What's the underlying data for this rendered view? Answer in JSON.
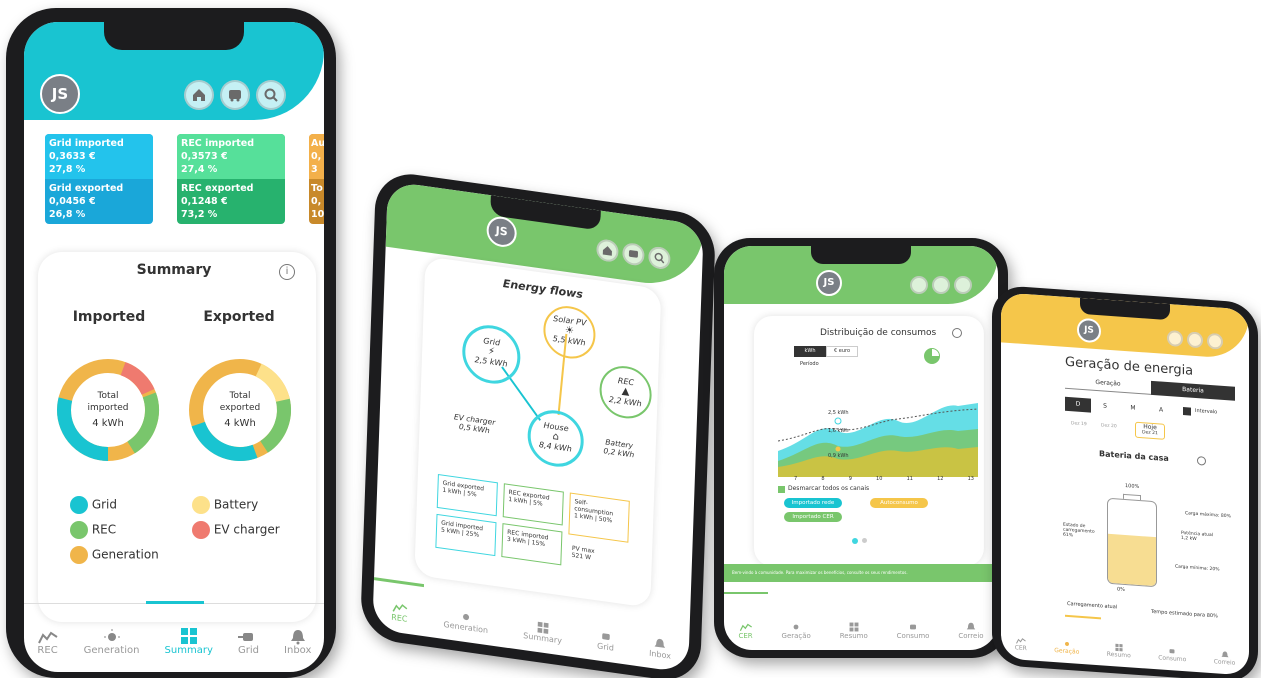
{
  "colors": {
    "teal": "#19c4d1",
    "green": "#79c66c",
    "yellow": "#f5c64a",
    "orange": "#f0b54a",
    "red": "#ef7a6f",
    "gold": "#e9b96a",
    "cyan": "#3fd6e0"
  },
  "phone1": {
    "avatar": "JS",
    "cards": [
      {
        "label": "Grid imported",
        "value": "0,3633 €",
        "pct": "27,8 %",
        "label2": "Grid exported",
        "value2": "0,0456 €",
        "pct2": "26,8 %"
      },
      {
        "label": "REC imported",
        "value": "0,3573 €",
        "pct": "27,4 %",
        "label2": "REC exported",
        "value2": "0,1248 €",
        "pct2": "73,2 %"
      },
      {
        "label": "Au",
        "value": "0,",
        "pct": "3",
        "label2": "To",
        "value2": "0,",
        "pct2": "10"
      }
    ],
    "summary_title": "Summary",
    "imported_title": "Imported",
    "exported_title": "Exported",
    "donut_imported": {
      "line1": "Total",
      "line2": "imported",
      "value": "4 kWh"
    },
    "donut_exported": {
      "line1": "Total",
      "line2": "exported",
      "value": "4 kWh"
    },
    "legend": [
      "Grid",
      "Battery",
      "REC",
      "EV charger",
      "Generation"
    ],
    "nav": [
      "REC",
      "Generation",
      "Summary",
      "Grid",
      "Inbox"
    ],
    "active_nav": "Summary"
  },
  "phone2": {
    "avatar": "JS",
    "title": "Energy flows",
    "solar": {
      "label": "Solar PV",
      "value": "5,5 kWh"
    },
    "grid": {
      "label": "Grid",
      "value": "2,5 kWh"
    },
    "rec": {
      "label": "REC",
      "value": "2,2 kWh"
    },
    "house": {
      "label": "House",
      "value": "8,4 kWh"
    },
    "ev": {
      "label": "EV charger",
      "value": "0,5 kWh"
    },
    "battery": {
      "label": "Battery",
      "value": "0,2 kWh"
    },
    "boxes": [
      {
        "l1": "Grid exported",
        "l2": "1 kWh | 5%"
      },
      {
        "l1": "REC exported",
        "l2": "1 kWh | 5%"
      },
      {
        "l1": "Self-",
        "l2": "consumption",
        "l3": "1 kWh | 50%"
      },
      {
        "l1": "Grid imported",
        "l2": "5 kWh | 25%"
      },
      {
        "l1": "REC imported",
        "l2": "3 kWh | 15%"
      },
      {
        "l1": "PV max",
        "l2": "521 W"
      }
    ],
    "nav": [
      "REC",
      "Generation",
      "Summary",
      "Grid",
      "Inbox"
    ],
    "active_nav": "REC"
  },
  "phone3": {
    "avatar": "JS",
    "title": "Distribuição de consumos",
    "tab1": "kWh",
    "tab2": "€ euro",
    "sub": "Período",
    "annotations": [
      "2,5 kWh",
      "1,6 kWh",
      "0,9 kWh"
    ],
    "x_ticks": [
      "7",
      "8",
      "9",
      "10",
      "11",
      "12",
      "13"
    ],
    "checkbox_label": "Desmarcar todos os canais",
    "chips": [
      "Importado rede",
      "Autoconsumo",
      "Importado CER"
    ],
    "banner": "Bem-vindo à comunidade. Para maximizar os benefícios, consulte os seus rendimentos.",
    "nav": [
      "CER",
      "Geração",
      "Resumo",
      "Consumo",
      "Correio"
    ],
    "active_nav": "CER"
  },
  "phone4": {
    "avatar": "JS",
    "title": "Geração de energia",
    "tab1": "Geração",
    "tab2": "Bateria",
    "periods": [
      "D",
      "S",
      "M",
      "A"
    ],
    "interval": "Intervalo",
    "dates": [
      "Dez 19",
      "Dez 20",
      "Hoje",
      "Dez 21"
    ],
    "battery_title": "Bateria da casa",
    "pct_top": "100%",
    "pct_bottom": "0%",
    "max_charge": "Carga máxima: 80%",
    "state_label": "Estado de carregamento",
    "state_value": "61%",
    "power_label": "Potência atual",
    "power_value": "1,2 kW",
    "min_charge": "Carga mínima: 20%",
    "current_label": "Carregamento atual",
    "estimated_label": "Tempo estimado para 80%",
    "nav": [
      "CER",
      "Geração",
      "Resumo",
      "Consumo",
      "Correio"
    ],
    "active_nav": "Geração"
  }
}
